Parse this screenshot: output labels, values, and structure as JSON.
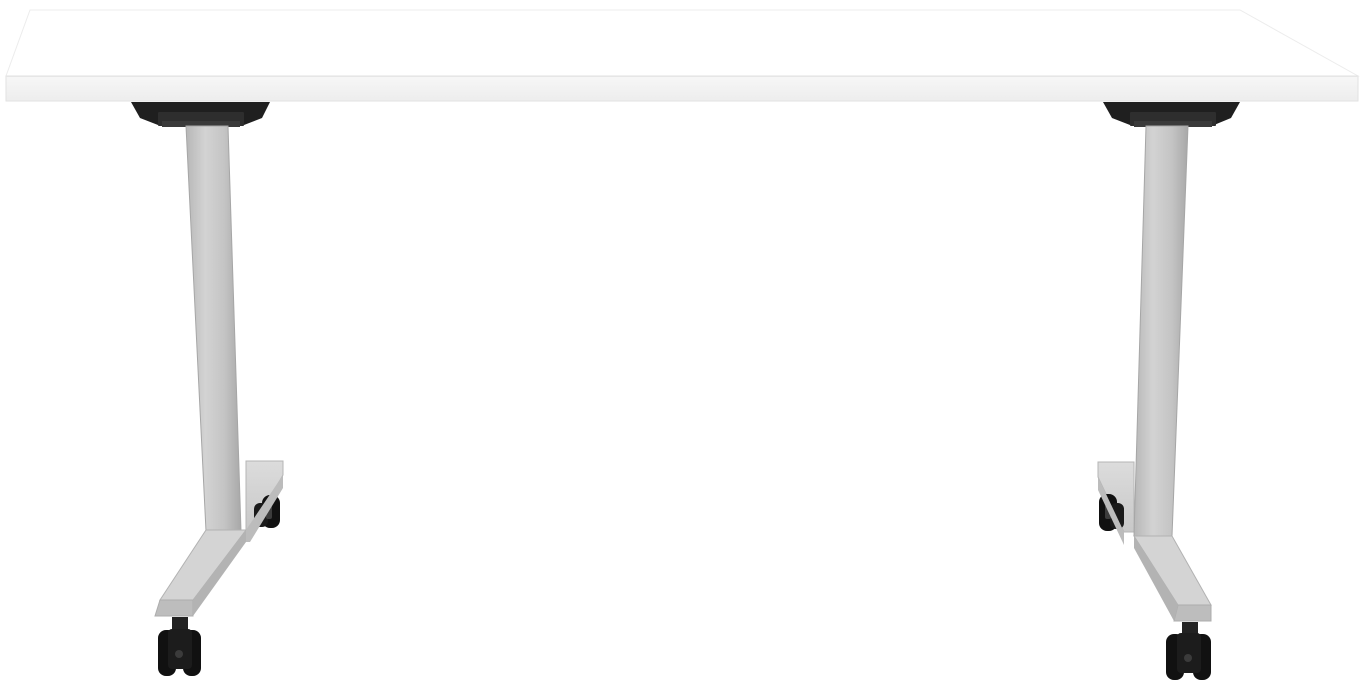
{
  "scene": {
    "subject": "table-product-photo",
    "background_color": "#ffffff",
    "tabletop_color": "#ffffff",
    "tabletop_edge_color": "#f2f2f2",
    "frame_color": "#c9c9c9",
    "frame_shade_color": "#a9a9a9",
    "hardware_color": "#1c1c1c",
    "caster_color": "#111111",
    "legs": [
      "left-leg",
      "right-leg"
    ],
    "casters": [
      "front-left-caster",
      "rear-left-caster",
      "front-right-caster",
      "rear-right-caster"
    ]
  }
}
